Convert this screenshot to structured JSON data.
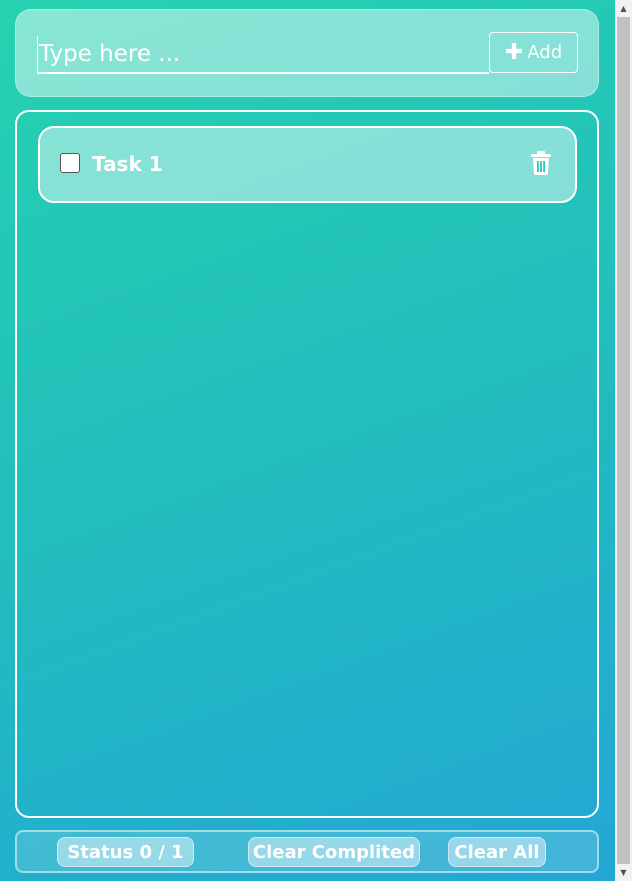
{
  "input": {
    "placeholder": "Type here ...",
    "value": ""
  },
  "add_button": {
    "label": "Add",
    "icon": "plus-icon"
  },
  "tasks": [
    {
      "label": "Task 1",
      "completed": false,
      "delete_icon": "trash-icon"
    }
  ],
  "footer": {
    "status_label": "Status 0 / 1",
    "clear_completed_label": "Clear Complited",
    "clear_all_label": "Clear All"
  },
  "colors": {
    "gradient_start": "#26d2b0",
    "gradient_end": "#23a6d5",
    "text": "#ffffff"
  }
}
